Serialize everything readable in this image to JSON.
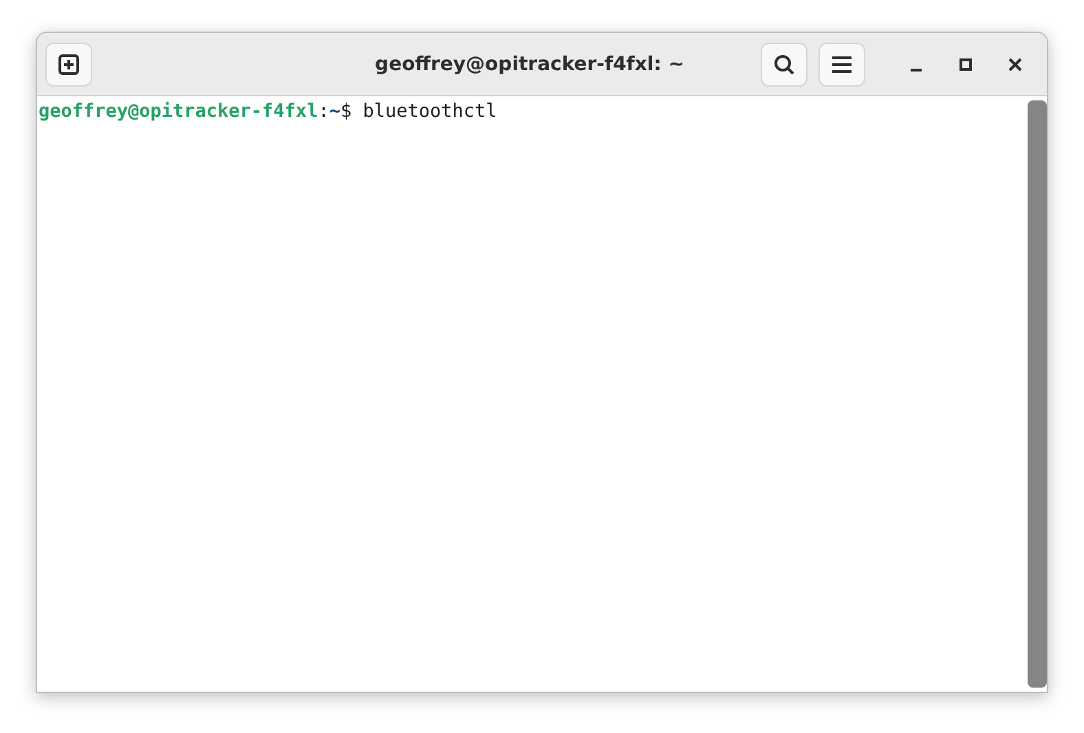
{
  "window": {
    "title": "geoffrey@opitracker-f4fxl: ~"
  },
  "terminal": {
    "lines": [
      {
        "segments": [
          {
            "kind": "user-host",
            "text": "geoffrey@opitracker-f4fxl"
          },
          {
            "kind": "separator",
            "text": ":"
          },
          {
            "kind": "path",
            "text": "~"
          },
          {
            "kind": "symbol",
            "text": "$ "
          },
          {
            "kind": "command",
            "text": "bluetoothctl"
          }
        ]
      }
    ]
  }
}
